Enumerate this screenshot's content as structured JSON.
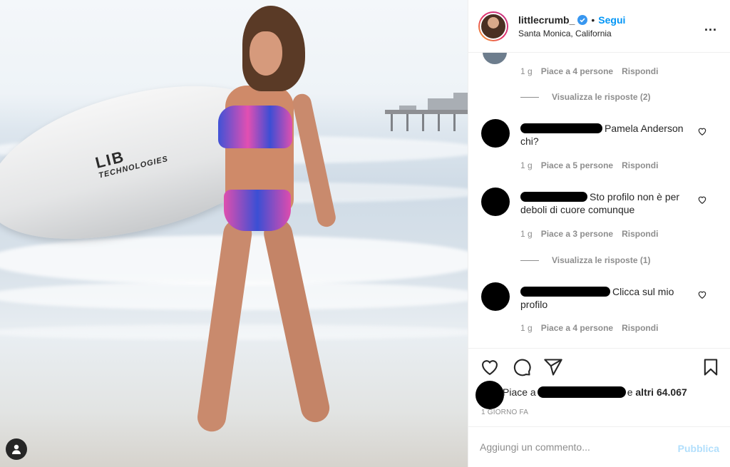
{
  "header": {
    "username": "littlecrumb_",
    "separator": "•",
    "follow_label": "Segui",
    "location": "Santa Monica, California",
    "more_label": "..."
  },
  "photo": {
    "board_text_main": "LIB",
    "board_text_sub": "TECHNOLOGIES"
  },
  "thread_top": {
    "meta": {
      "age": "1 g",
      "likes": "Piace a 4 persone",
      "reply": "Rispondi"
    },
    "view_replies": "Visualizza le risposte (2)"
  },
  "comments": [
    {
      "text": "Pamela Anderson chi?",
      "age": "1 g",
      "likes": "Piace a 5 persone",
      "reply": "Rispondi"
    },
    {
      "text": "Sto profilo non è per deboli di cuore comunque",
      "age": "1 g",
      "likes": "Piace a 3 persone",
      "reply": "Rispondi",
      "view_replies": "Visualizza le risposte (1)"
    },
    {
      "text": "Clicca sul mio profilo",
      "age": "1 g",
      "likes": "Piace a 4 persone",
      "reply": "Rispondi"
    }
  ],
  "likes": {
    "prefix": "Piace a",
    "conjunction": "e",
    "others": "altri 64.067"
  },
  "posted_ago": "1 GIORNO FA",
  "add_comment": {
    "placeholder": "Aggiungi un commento...",
    "publish_label": "Pubblica"
  },
  "colors": {
    "accent": "#0095f6",
    "publish_disabled": "#b2dffc",
    "muted_text": "#8e8e8e"
  },
  "icons": [
    "verified-badge-icon",
    "more-options-icon",
    "heart-icon",
    "comment-icon",
    "share-icon",
    "bookmark-icon",
    "user-tag-icon"
  ]
}
